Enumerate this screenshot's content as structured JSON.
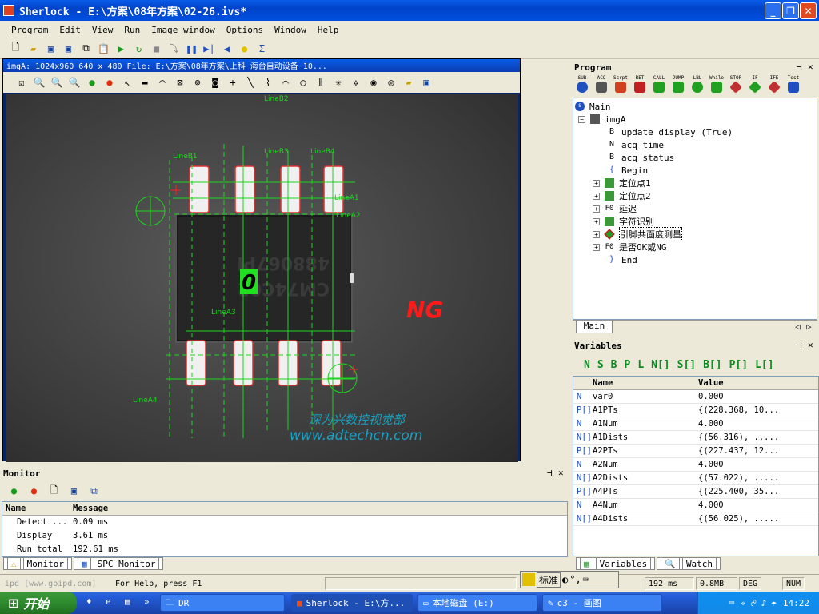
{
  "window": {
    "title": "Sherlock - E:\\方案\\08年方案\\02-26.ivs*",
    "minimize": "_",
    "maximize": "❐",
    "close": "✕"
  },
  "menu": [
    "Program",
    "Edit",
    "View",
    "Run",
    "Image window",
    "Options",
    "Window",
    "Help"
  ],
  "image_window": {
    "title": "imgA: 1024x960 640 x 480   File: E:\\方案\\08年方案\\上科   海台自动设备   10...",
    "overlay_labels": {
      "lineb1": "LineB1",
      "lineb2": "LineB2",
      "lineb3": "LineB3",
      "lineb4": "LineB4",
      "linea1": "LineA1",
      "linea2": "LineA2",
      "linea3": "LineA3",
      "linea4": "LineA4"
    },
    "ocr_result": "0",
    "status": "NG",
    "chip_text_line1": "488067Pl",
    "chip_text_line2": "CM74C02",
    "watermark_line1": "深为兴数控视觉部",
    "watermark_line2": "www.adtechcn.com"
  },
  "program": {
    "title": "Program",
    "tools": [
      "SUB",
      "ACQ",
      "Scrpt",
      "RET",
      "CALL",
      "JUMP",
      "LBL",
      "While",
      "STOP",
      "IF",
      "IFE",
      "Test"
    ],
    "tree": [
      {
        "label": "Main",
        "icon": "SUB"
      },
      {
        "label": "imgA",
        "icon": "cam"
      },
      {
        "label": "update display (True)",
        "icon": "B"
      },
      {
        "label": "acq time",
        "icon": "N"
      },
      {
        "label": "acq status",
        "icon": "B"
      },
      {
        "label": "Begin",
        "icon": "{"
      },
      {
        "label": "定位点1",
        "icon": "grn"
      },
      {
        "label": "定位点2",
        "icon": "grn"
      },
      {
        "label": "延迟",
        "icon": "F0"
      },
      {
        "label": "字符识别",
        "icon": "grn"
      },
      {
        "label": "引脚共面度测量",
        "icon": "dia"
      },
      {
        "label": "是否OK或NG",
        "icon": "F0"
      },
      {
        "label": "End",
        "icon": "}"
      }
    ],
    "tab": "Main"
  },
  "variables": {
    "title": "Variables",
    "type_tools": [
      "N",
      "S",
      "B",
      "P",
      "L",
      "N[]",
      "S[]",
      "B[]",
      "P[]",
      "L[]"
    ],
    "columns": [
      "Name",
      "Value"
    ],
    "rows": [
      {
        "type": "N",
        "name": "var0",
        "value": "0.000"
      },
      {
        "type": "P[]",
        "name": "A1PTs",
        "value": "{(228.368, 10..."
      },
      {
        "type": "N",
        "name": "A1Num",
        "value": "4.000"
      },
      {
        "type": "N[]",
        "name": "A1Dists",
        "value": "{(56.316), ....."
      },
      {
        "type": "P[]",
        "name": "A2PTs",
        "value": "{(227.437, 12..."
      },
      {
        "type": "N",
        "name": "A2Num",
        "value": "4.000"
      },
      {
        "type": "N[]",
        "name": "A2Dists",
        "value": "{(57.022), ....."
      },
      {
        "type": "P[]",
        "name": "A4PTs",
        "value": "{(225.400, 35..."
      },
      {
        "type": "N",
        "name": "A4Num",
        "value": "4.000"
      },
      {
        "type": "N[]",
        "name": "A4Dists",
        "value": "{(56.025), ....."
      }
    ],
    "tabs": [
      "Variables",
      "Watch"
    ]
  },
  "monitor": {
    "title": "Monitor",
    "columns": [
      "Name",
      "Message"
    ],
    "rows": [
      {
        "name": "Detect ...",
        "message": "0.09 ms"
      },
      {
        "name": "Display",
        "message": "3.61 ms"
      },
      {
        "name": "Run total",
        "message": "192.61 ms"
      }
    ],
    "tabs": [
      "Monitor",
      "SPC Monitor"
    ]
  },
  "statusbar": {
    "left": "ipd [www.goipd.com]",
    "help": "For Help, press F1",
    "time": "192 ms",
    "mem": "0.8MB",
    "deg": "DEG",
    "num": "NUM"
  },
  "ime": {
    "label": "标准"
  },
  "taskbar": {
    "start": "开始",
    "tasks": [
      "DR",
      "Sherlock - E:\\方...",
      "本地磁盘 (E:)",
      "c3 - 画图"
    ],
    "clock": "14:22"
  }
}
